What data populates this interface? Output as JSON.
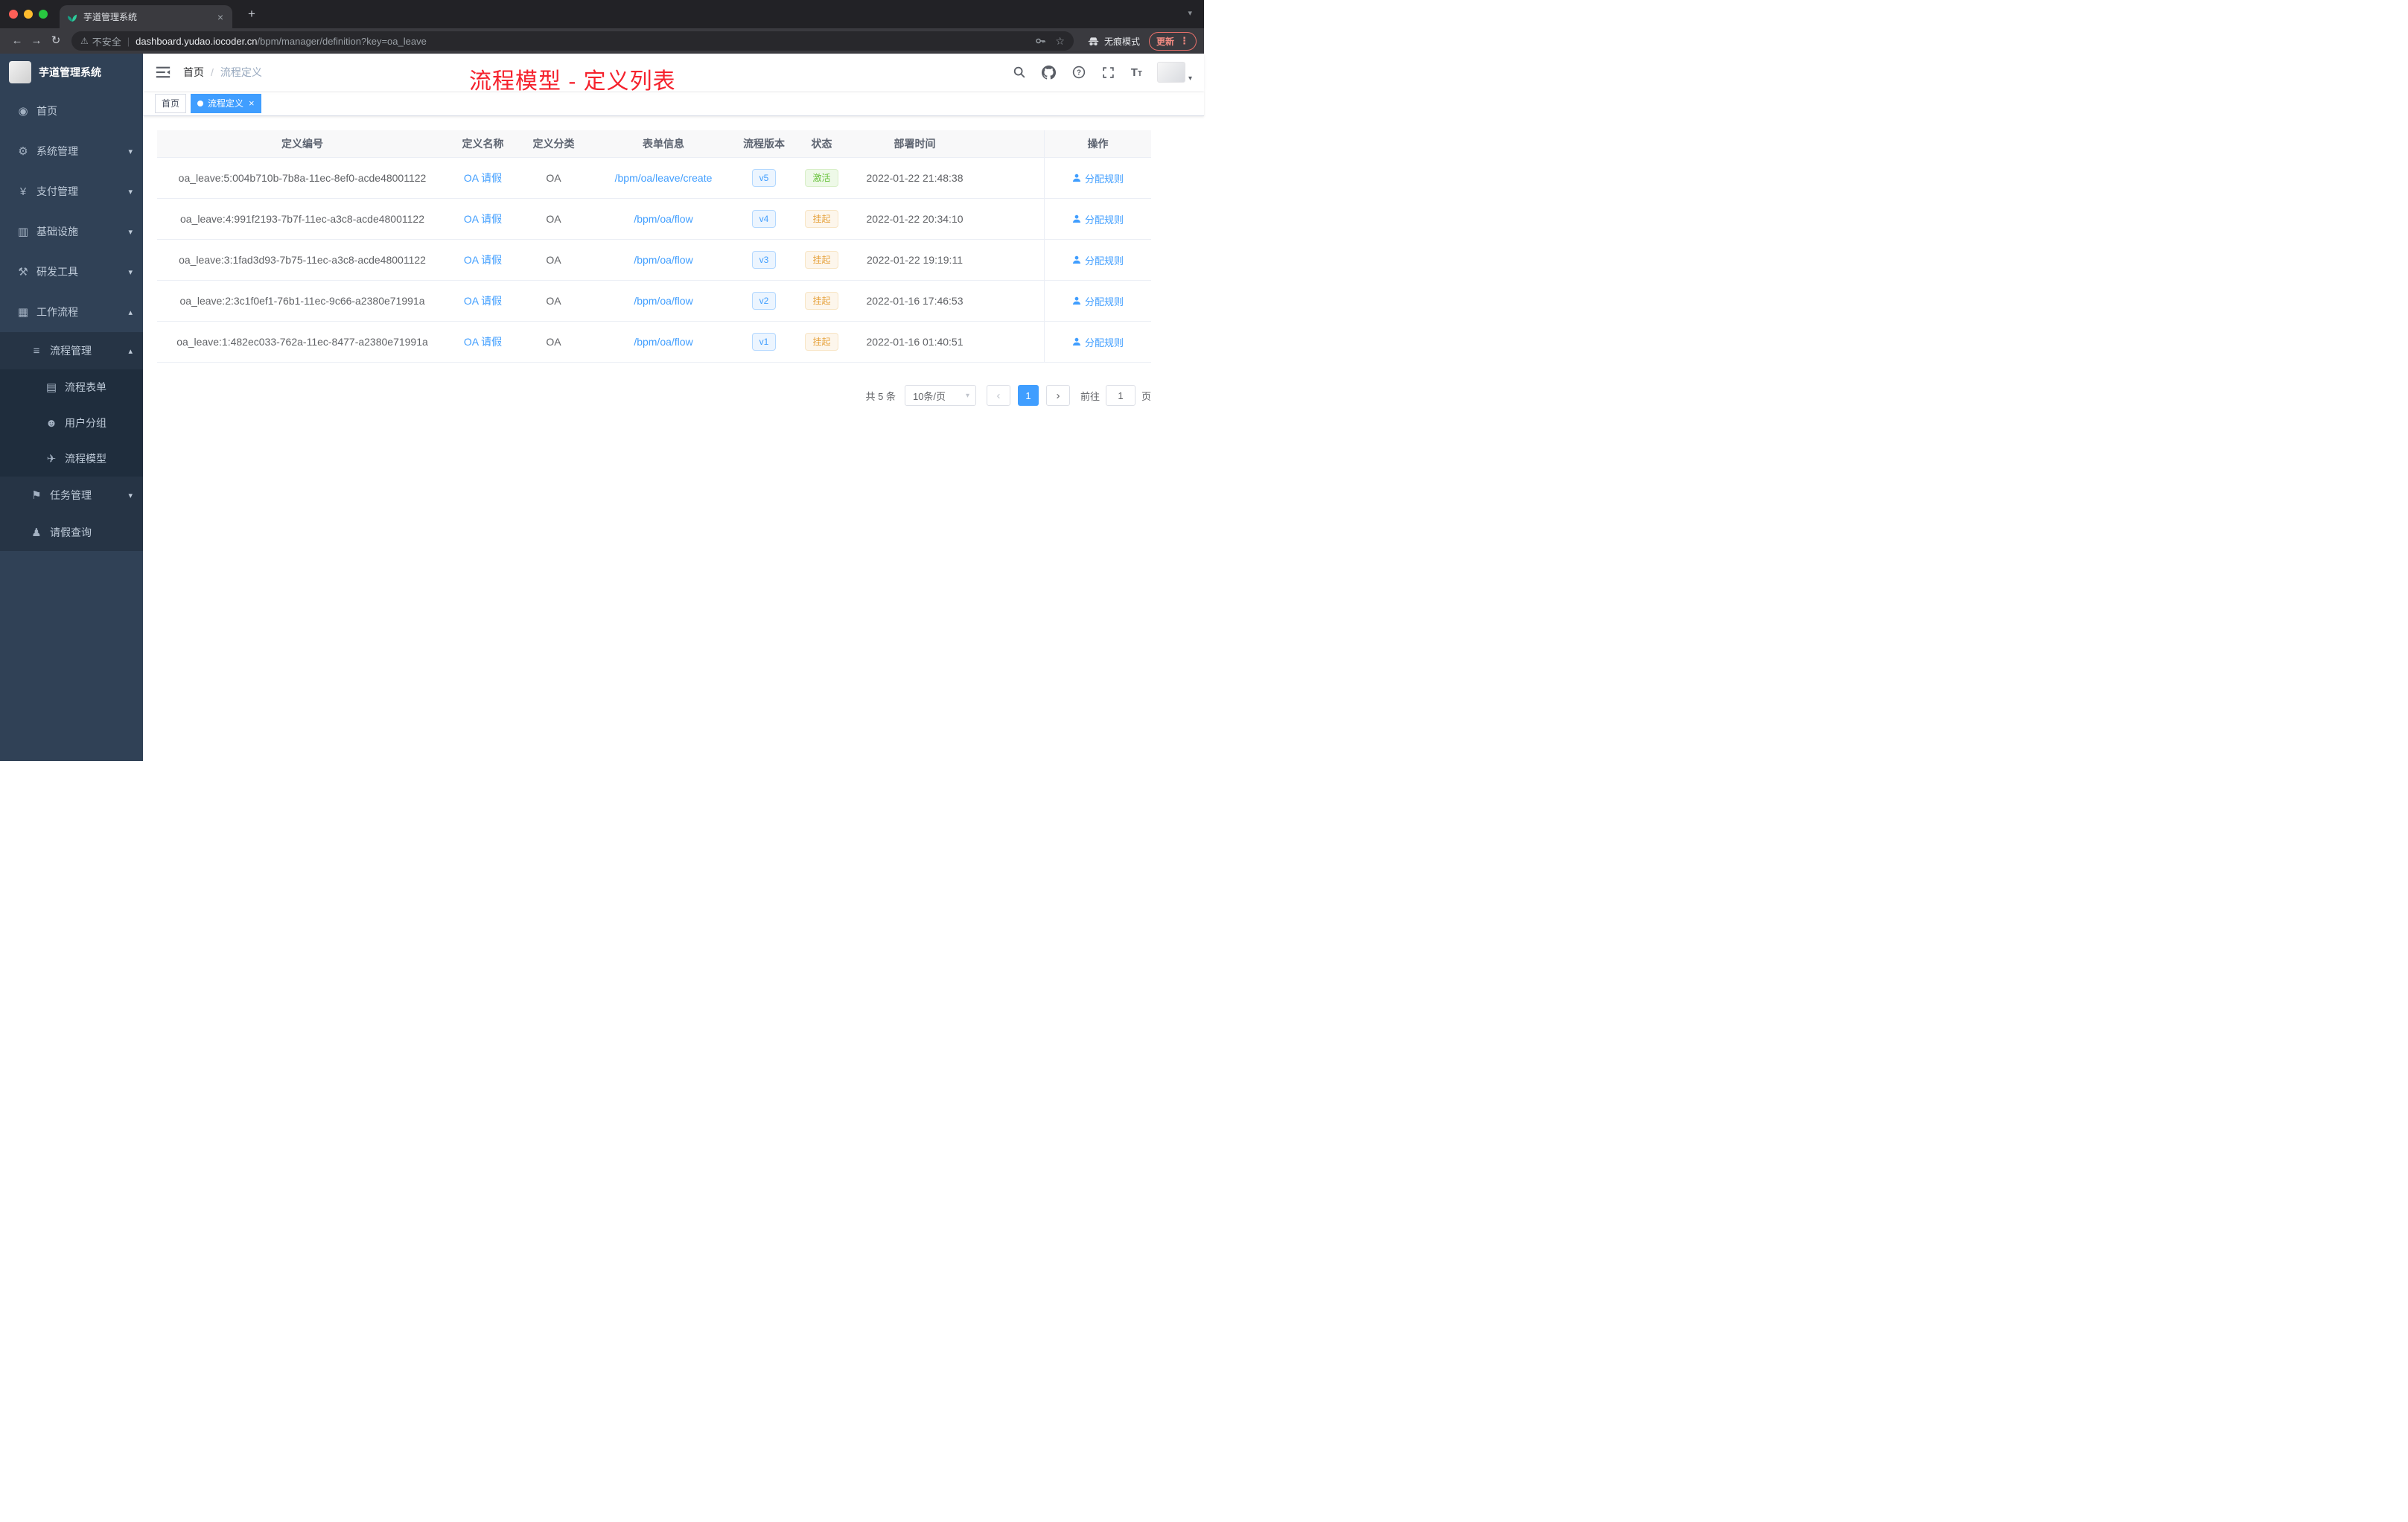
{
  "browser": {
    "tab_title": "芋道管理系统",
    "close_tab": "×",
    "new_tab": "+",
    "tab_caret": "▾",
    "back": "←",
    "forward": "→",
    "reload": "↻",
    "warn": "⚠",
    "not_secure": "不安全",
    "url_divider": "|",
    "url_domain": "dashboard.yudao.iocoder.cn",
    "url_path": "/bpm/manager/definition?key=oa_leave",
    "star": "☆",
    "incognito_label": "无痕模式",
    "update_label": "更新",
    "menu_dots": "⋮"
  },
  "sidebar": {
    "logo_title": "芋道管理系统",
    "items": {
      "home": "首页",
      "system": "系统管理",
      "payment": "支付管理",
      "infra": "基础设施",
      "devtools": "研发工具",
      "workflow": "工作流程",
      "process_mgmt": "流程管理",
      "process_form": "流程表单",
      "user_group": "用户分组",
      "process_model": "流程模型",
      "task_mgmt": "任务管理",
      "leave_query": "请假查询"
    },
    "icons": {
      "home": "◉",
      "system": "⚙",
      "payment": "¥",
      "infra": "▥",
      "devtools": "⚒",
      "workflow": "▦",
      "process_mgmt": "≡",
      "process_form": "▤",
      "user_group": "☻",
      "process_model": "✈",
      "task_mgmt": "⚑",
      "leave_query": "♟",
      "arrow_down": "▾",
      "arrow_up": "▴"
    }
  },
  "header": {
    "breadcrumb_home": "首页",
    "breadcrumb_sep": "/",
    "breadcrumb_current": "流程定义",
    "annotation": "流程模型 - 定义列表"
  },
  "tags": {
    "home": "首页",
    "active": "流程定义",
    "close": "×"
  },
  "table": {
    "columns": [
      "定义编号",
      "定义名称",
      "定义分类",
      "表单信息",
      "流程版本",
      "状态",
      "部署时间",
      "操作"
    ],
    "rows": [
      {
        "id": "oa_leave:5:004b710b-7b8a-11ec-8ef0-acde48001122",
        "name": "OA 请假",
        "category": "OA",
        "form": "/bpm/oa/leave/create",
        "version": "v5",
        "status": "激活",
        "time": "2022-01-22 21:48:38",
        "action": "分配规则"
      },
      {
        "id": "oa_leave:4:991f2193-7b7f-11ec-a3c8-acde48001122",
        "name": "OA 请假",
        "category": "OA",
        "form": "/bpm/oa/flow",
        "version": "v4",
        "status": "挂起",
        "time": "2022-01-22 20:34:10",
        "action": "分配规则"
      },
      {
        "id": "oa_leave:3:1fad3d93-7b75-11ec-a3c8-acde48001122",
        "name": "OA 请假",
        "category": "OA",
        "form": "/bpm/oa/flow",
        "version": "v3",
        "status": "挂起",
        "time": "2022-01-22 19:19:11",
        "action": "分配规则"
      },
      {
        "id": "oa_leave:2:3c1f0ef1-76b1-11ec-9c66-a2380e71991a",
        "name": "OA 请假",
        "category": "OA",
        "form": "/bpm/oa/flow",
        "version": "v2",
        "status": "挂起",
        "time": "2022-01-16 17:46:53",
        "action": "分配规则"
      },
      {
        "id": "oa_leave:1:482ec033-762a-11ec-8477-a2380e71991a",
        "name": "OA 请假",
        "category": "OA",
        "form": "/bpm/oa/flow",
        "version": "v1",
        "status": "挂起",
        "time": "2022-01-16 01:40:51",
        "action": "分配规则"
      }
    ]
  },
  "pagination": {
    "total": "共 5 条",
    "page_size": "10条/页",
    "select_caret": "▾",
    "prev": "‹",
    "next": "›",
    "page": "1",
    "goto_label": "前往",
    "goto_value": "1",
    "page_unit": "页"
  },
  "colors": {
    "accent": "#409eff",
    "success": "#67c23a",
    "warning": "#e6a23c",
    "annotation_red": "#f5222d",
    "sidebar_bg": "#304156"
  }
}
